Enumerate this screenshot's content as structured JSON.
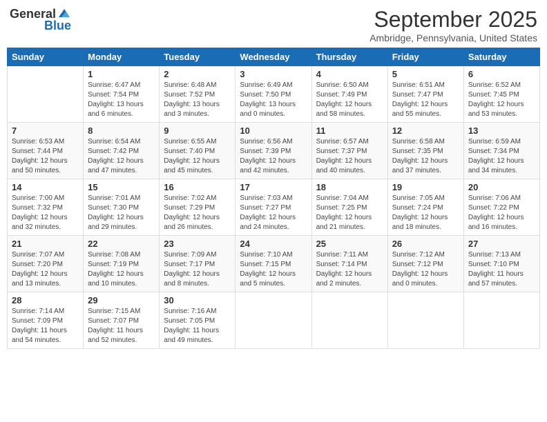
{
  "logo": {
    "general": "General",
    "blue": "Blue"
  },
  "title": "September 2025",
  "location": "Ambridge, Pennsylvania, United States",
  "days_of_week": [
    "Sunday",
    "Monday",
    "Tuesday",
    "Wednesday",
    "Thursday",
    "Friday",
    "Saturday"
  ],
  "weeks": [
    [
      {
        "day": "",
        "sunrise": "",
        "sunset": "",
        "daylight": ""
      },
      {
        "day": "1",
        "sunrise": "Sunrise: 6:47 AM",
        "sunset": "Sunset: 7:54 PM",
        "daylight": "Daylight: 13 hours and 6 minutes."
      },
      {
        "day": "2",
        "sunrise": "Sunrise: 6:48 AM",
        "sunset": "Sunset: 7:52 PM",
        "daylight": "Daylight: 13 hours and 3 minutes."
      },
      {
        "day": "3",
        "sunrise": "Sunrise: 6:49 AM",
        "sunset": "Sunset: 7:50 PM",
        "daylight": "Daylight: 13 hours and 0 minutes."
      },
      {
        "day": "4",
        "sunrise": "Sunrise: 6:50 AM",
        "sunset": "Sunset: 7:49 PM",
        "daylight": "Daylight: 12 hours and 58 minutes."
      },
      {
        "day": "5",
        "sunrise": "Sunrise: 6:51 AM",
        "sunset": "Sunset: 7:47 PM",
        "daylight": "Daylight: 12 hours and 55 minutes."
      },
      {
        "day": "6",
        "sunrise": "Sunrise: 6:52 AM",
        "sunset": "Sunset: 7:45 PM",
        "daylight": "Daylight: 12 hours and 53 minutes."
      }
    ],
    [
      {
        "day": "7",
        "sunrise": "Sunrise: 6:53 AM",
        "sunset": "Sunset: 7:44 PM",
        "daylight": "Daylight: 12 hours and 50 minutes."
      },
      {
        "day": "8",
        "sunrise": "Sunrise: 6:54 AM",
        "sunset": "Sunset: 7:42 PM",
        "daylight": "Daylight: 12 hours and 47 minutes."
      },
      {
        "day": "9",
        "sunrise": "Sunrise: 6:55 AM",
        "sunset": "Sunset: 7:40 PM",
        "daylight": "Daylight: 12 hours and 45 minutes."
      },
      {
        "day": "10",
        "sunrise": "Sunrise: 6:56 AM",
        "sunset": "Sunset: 7:39 PM",
        "daylight": "Daylight: 12 hours and 42 minutes."
      },
      {
        "day": "11",
        "sunrise": "Sunrise: 6:57 AM",
        "sunset": "Sunset: 7:37 PM",
        "daylight": "Daylight: 12 hours and 40 minutes."
      },
      {
        "day": "12",
        "sunrise": "Sunrise: 6:58 AM",
        "sunset": "Sunset: 7:35 PM",
        "daylight": "Daylight: 12 hours and 37 minutes."
      },
      {
        "day": "13",
        "sunrise": "Sunrise: 6:59 AM",
        "sunset": "Sunset: 7:34 PM",
        "daylight": "Daylight: 12 hours and 34 minutes."
      }
    ],
    [
      {
        "day": "14",
        "sunrise": "Sunrise: 7:00 AM",
        "sunset": "Sunset: 7:32 PM",
        "daylight": "Daylight: 12 hours and 32 minutes."
      },
      {
        "day": "15",
        "sunrise": "Sunrise: 7:01 AM",
        "sunset": "Sunset: 7:30 PM",
        "daylight": "Daylight: 12 hours and 29 minutes."
      },
      {
        "day": "16",
        "sunrise": "Sunrise: 7:02 AM",
        "sunset": "Sunset: 7:29 PM",
        "daylight": "Daylight: 12 hours and 26 minutes."
      },
      {
        "day": "17",
        "sunrise": "Sunrise: 7:03 AM",
        "sunset": "Sunset: 7:27 PM",
        "daylight": "Daylight: 12 hours and 24 minutes."
      },
      {
        "day": "18",
        "sunrise": "Sunrise: 7:04 AM",
        "sunset": "Sunset: 7:25 PM",
        "daylight": "Daylight: 12 hours and 21 minutes."
      },
      {
        "day": "19",
        "sunrise": "Sunrise: 7:05 AM",
        "sunset": "Sunset: 7:24 PM",
        "daylight": "Daylight: 12 hours and 18 minutes."
      },
      {
        "day": "20",
        "sunrise": "Sunrise: 7:06 AM",
        "sunset": "Sunset: 7:22 PM",
        "daylight": "Daylight: 12 hours and 16 minutes."
      }
    ],
    [
      {
        "day": "21",
        "sunrise": "Sunrise: 7:07 AM",
        "sunset": "Sunset: 7:20 PM",
        "daylight": "Daylight: 12 hours and 13 minutes."
      },
      {
        "day": "22",
        "sunrise": "Sunrise: 7:08 AM",
        "sunset": "Sunset: 7:19 PM",
        "daylight": "Daylight: 12 hours and 10 minutes."
      },
      {
        "day": "23",
        "sunrise": "Sunrise: 7:09 AM",
        "sunset": "Sunset: 7:17 PM",
        "daylight": "Daylight: 12 hours and 8 minutes."
      },
      {
        "day": "24",
        "sunrise": "Sunrise: 7:10 AM",
        "sunset": "Sunset: 7:15 PM",
        "daylight": "Daylight: 12 hours and 5 minutes."
      },
      {
        "day": "25",
        "sunrise": "Sunrise: 7:11 AM",
        "sunset": "Sunset: 7:14 PM",
        "daylight": "Daylight: 12 hours and 2 minutes."
      },
      {
        "day": "26",
        "sunrise": "Sunrise: 7:12 AM",
        "sunset": "Sunset: 7:12 PM",
        "daylight": "Daylight: 12 hours and 0 minutes."
      },
      {
        "day": "27",
        "sunrise": "Sunrise: 7:13 AM",
        "sunset": "Sunset: 7:10 PM",
        "daylight": "Daylight: 11 hours and 57 minutes."
      }
    ],
    [
      {
        "day": "28",
        "sunrise": "Sunrise: 7:14 AM",
        "sunset": "Sunset: 7:09 PM",
        "daylight": "Daylight: 11 hours and 54 minutes."
      },
      {
        "day": "29",
        "sunrise": "Sunrise: 7:15 AM",
        "sunset": "Sunset: 7:07 PM",
        "daylight": "Daylight: 11 hours and 52 minutes."
      },
      {
        "day": "30",
        "sunrise": "Sunrise: 7:16 AM",
        "sunset": "Sunset: 7:05 PM",
        "daylight": "Daylight: 11 hours and 49 minutes."
      },
      {
        "day": "",
        "sunrise": "",
        "sunset": "",
        "daylight": ""
      },
      {
        "day": "",
        "sunrise": "",
        "sunset": "",
        "daylight": ""
      },
      {
        "day": "",
        "sunrise": "",
        "sunset": "",
        "daylight": ""
      },
      {
        "day": "",
        "sunrise": "",
        "sunset": "",
        "daylight": ""
      }
    ]
  ]
}
